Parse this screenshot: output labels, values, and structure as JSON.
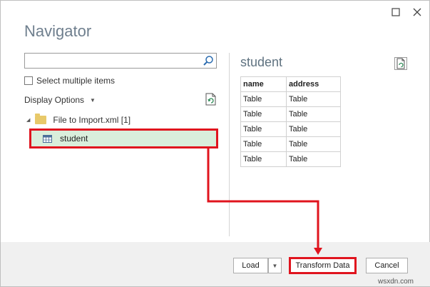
{
  "window": {
    "title": "Navigator",
    "controls": {
      "maximize_icon": "maximize-icon",
      "close_icon": "close-icon"
    }
  },
  "left": {
    "search": {
      "value": "",
      "placeholder": ""
    },
    "select_multiple_label": "Select multiple items",
    "display_options_label": "Display Options",
    "tree": {
      "folder_label": "File to Import.xml [1]",
      "items": [
        {
          "label": "student",
          "selected": true
        }
      ]
    }
  },
  "preview": {
    "title": "student",
    "columns": [
      "name",
      "address"
    ],
    "rows": [
      [
        "Table",
        "Table"
      ],
      [
        "Table",
        "Table"
      ],
      [
        "Table",
        "Table"
      ],
      [
        "Table",
        "Table"
      ],
      [
        "Table",
        "Table"
      ]
    ]
  },
  "footer": {
    "load_label": "Load",
    "transform_label": "Transform Data",
    "cancel_label": "Cancel"
  },
  "watermark": "wsxdn.com",
  "colors": {
    "highlight": "#e0141e",
    "selected_bg": "#d9eedb"
  }
}
